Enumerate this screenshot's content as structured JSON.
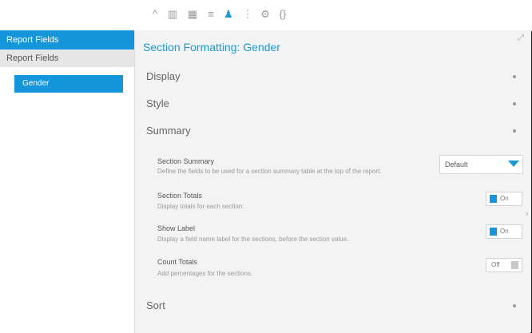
{
  "toolbar": {
    "icons": [
      "chevron-up-icon",
      "columns-icon",
      "grid-icon",
      "lines-icon",
      "person-icon",
      "dots-icon",
      "settings-icon",
      "code-icon"
    ],
    "glyphs": [
      "^",
      "▥",
      "▦",
      "≡",
      "♟",
      "⋮",
      "⚙",
      "{}"
    ],
    "active_index": 4
  },
  "sidebar": {
    "header": "Report Fields",
    "subheader": "Report Fields",
    "items": [
      {
        "label": "Gender"
      }
    ]
  },
  "panel": {
    "title": "Section Formatting: Gender",
    "corner_icon": "⤢",
    "sections": [
      {
        "label": "Display"
      },
      {
        "label": "Style"
      },
      {
        "label": "Summary"
      },
      {
        "label": "Sort"
      }
    ]
  },
  "summary_options": [
    {
      "title": "Section Summary",
      "desc": "Define the fields to be used for a section summary table at the top of the report.",
      "control": "dropdown",
      "value": "Default"
    },
    {
      "title": "Section Totals",
      "desc": "Display totals for each section.",
      "control": "toggle",
      "state": "on",
      "value": "On"
    },
    {
      "title": "Show Label",
      "desc": "Display a field name label for the sections, before the section value.",
      "control": "toggle",
      "state": "on",
      "value": "On"
    },
    {
      "title": "Count Totals",
      "desc": "Add percentages for the sections.",
      "control": "toggle",
      "state": "off",
      "value": "Off"
    }
  ],
  "colors": {
    "accent": "#1596dc",
    "panel_bg": "#f3f3f3",
    "sidebar_sub": "#e6e6e6"
  }
}
